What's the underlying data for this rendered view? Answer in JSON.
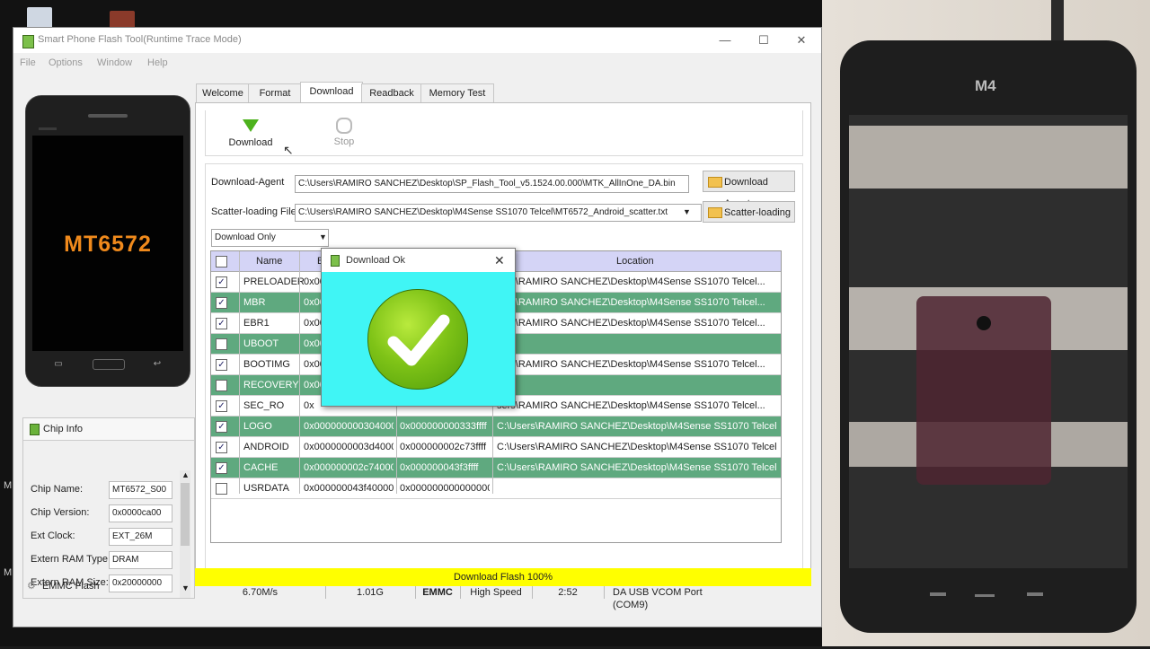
{
  "window": {
    "title": "Smart Phone Flash Tool(Runtime Trace Mode)"
  },
  "menu": [
    "File",
    "Options",
    "Window",
    "Help"
  ],
  "phone": {
    "chip_text": "MT6572"
  },
  "chip_info": {
    "header": "Chip Info",
    "rows": [
      {
        "label": "Chip Name:",
        "value": "MT6572_S00"
      },
      {
        "label": "Chip Version:",
        "value": "0x0000ca00"
      },
      {
        "label": "Ext Clock:",
        "value": "EXT_26M"
      },
      {
        "label": "Extern RAM Type:",
        "value": "DRAM"
      },
      {
        "label": "Extern RAM Size:",
        "value": "0x20000000"
      }
    ],
    "footer": "EMMC Flash"
  },
  "tabs": [
    "Welcome",
    "Format",
    "Download",
    "Readback",
    "Memory Test"
  ],
  "active_tab": "Download",
  "toolbar": {
    "download_label": "Download",
    "stop_label": "Stop"
  },
  "fields": {
    "download_agent_label": "Download-Agent",
    "download_agent_value": "C:\\Users\\RAMIRO SANCHEZ\\Desktop\\SP_Flash_Tool_v5.1524.00.000\\MTK_AllInOne_DA.bin",
    "download_agent_button": "Download Agent",
    "scatter_label": "Scatter-loading File",
    "scatter_value": "C:\\Users\\RAMIRO SANCHEZ\\Desktop\\M4Sense SS1070 Telcel\\MT6572_Android_scatter.txt",
    "scatter_button": "Scatter-loading",
    "mode_value": "Download Only"
  },
  "table": {
    "headers": [
      "Name",
      "B",
      "",
      "Location"
    ],
    "rows": [
      {
        "checked": true,
        "name": "PRELOADER",
        "begin": "0x00",
        "end": "",
        "location": "sers\\RAMIRO SANCHEZ\\Desktop\\M4Sense SS1070 Telcel...",
        "hl": false
      },
      {
        "checked": true,
        "name": "MBR",
        "begin": "0x00",
        "end": "",
        "location": "sers\\RAMIRO SANCHEZ\\Desktop\\M4Sense SS1070 Telcel...",
        "hl": true
      },
      {
        "checked": true,
        "name": "EBR1",
        "begin": "0x00",
        "end": "",
        "location": "sers\\RAMIRO SANCHEZ\\Desktop\\M4Sense SS1070 Telcel...",
        "hl": false
      },
      {
        "checked": false,
        "name": "UBOOT",
        "begin": "0x00",
        "end": "",
        "location": "",
        "hl": true
      },
      {
        "checked": true,
        "name": "BOOTIMG",
        "begin": "0x00",
        "end": "",
        "location": "sers\\RAMIRO SANCHEZ\\Desktop\\M4Sense SS1070 Telcel...",
        "hl": false
      },
      {
        "checked": false,
        "name": "RECOVERY",
        "begin": "0x00",
        "end": "",
        "location": "",
        "hl": true
      },
      {
        "checked": true,
        "name": "SEC_RO",
        "begin": "0x",
        "end": "",
        "location": "sers\\RAMIRO SANCHEZ\\Desktop\\M4Sense SS1070 Telcel...",
        "hl": false
      },
      {
        "checked": true,
        "name": "LOGO",
        "begin": "0x0000000003040000",
        "end": "0x000000000333ffff",
        "location": "C:\\Users\\RAMIRO SANCHEZ\\Desktop\\M4Sense SS1070 Telcel...",
        "hl": true
      },
      {
        "checked": true,
        "name": "ANDROID",
        "begin": "0x0000000003d40000",
        "end": "0x000000002c73ffff",
        "location": "C:\\Users\\RAMIRO SANCHEZ\\Desktop\\M4Sense SS1070 Telcel...",
        "hl": false
      },
      {
        "checked": true,
        "name": "CACHE",
        "begin": "0x000000002c740000",
        "end": "0x000000043f3ffff",
        "location": "C:\\Users\\RAMIRO SANCHEZ\\Desktop\\M4Sense SS1070 Telcel...",
        "hl": true
      },
      {
        "checked": false,
        "name": "USRDATA",
        "begin": "0x000000043f40000",
        "end": "0x0000000000000000",
        "location": "",
        "hl": false
      }
    ]
  },
  "status": {
    "text": "Download Flash 100%",
    "progress": 1.0
  },
  "info": [
    "6.70M/s",
    "1.01G",
    "EMMC",
    "High Speed",
    "2:52",
    "DA USB VCOM Port (COM9)"
  ],
  "dialog": {
    "title": "Download Ok"
  },
  "right_phone": {
    "brand": "M4"
  }
}
